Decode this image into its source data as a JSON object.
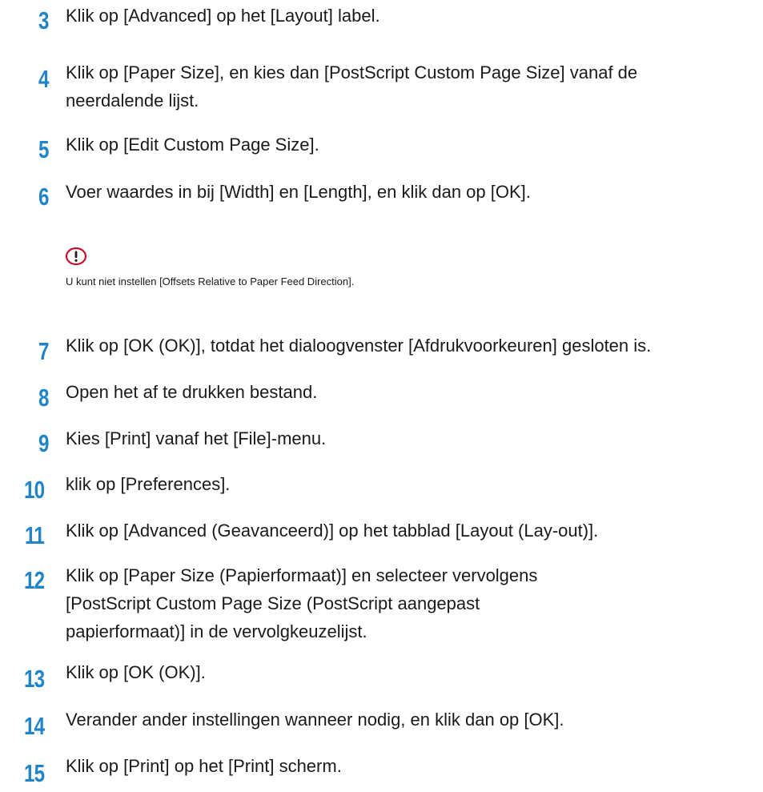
{
  "steps": [
    {
      "num": "3",
      "text": "Klik op [Advanced] op het [Layout] label."
    },
    {
      "num": "4",
      "text": "Klik op [Paper Size], en kies dan [PostScript Custom Page Size] vanaf de neerdalende lijst."
    },
    {
      "num": "5",
      "text": "Klik op [Edit Custom Page Size]."
    },
    {
      "num": "6",
      "text": "Voer waardes in bij [Width] en [Length], en klik dan op [OK]."
    },
    {
      "num": "7",
      "text": "Klik op [OK (OK)], totdat het dialoogvenster [Afdrukvoorkeuren] gesloten is."
    },
    {
      "num": "8",
      "text": "Open het af te drukken bestand."
    },
    {
      "num": "9",
      "text": "Kies [Print] vanaf het [File]-menu."
    },
    {
      "num": "10",
      "text": "klik op [Preferences]."
    },
    {
      "num": "11",
      "text": "Klik op [Advanced (Geavanceerd)] op het tabblad [Layout (Lay-out)]."
    },
    {
      "num": "12",
      "text": "Klik op [Paper Size (Papierformaat)] en selecteer vervolgens [PostScript Custom Page Size (PostScript aangepast papierformaat)] in de vervolgkeuzelijst."
    },
    {
      "num": "13",
      "text": "Klik op [OK (OK)]."
    },
    {
      "num": "14",
      "text": "Verander ander instellingen wanneer nodig, en klik dan op [OK]."
    },
    {
      "num": "15",
      "text": "Klik op [Print] op het [Print] scherm."
    }
  ],
  "note": {
    "icon": "caution-icon",
    "text": "U kunt niet instellen [Offsets Relative to Paper Feed Direction]."
  },
  "colors": {
    "step_number": "#1f84c8",
    "note_icon": "#c8102e",
    "text": "#1a1a1a"
  }
}
